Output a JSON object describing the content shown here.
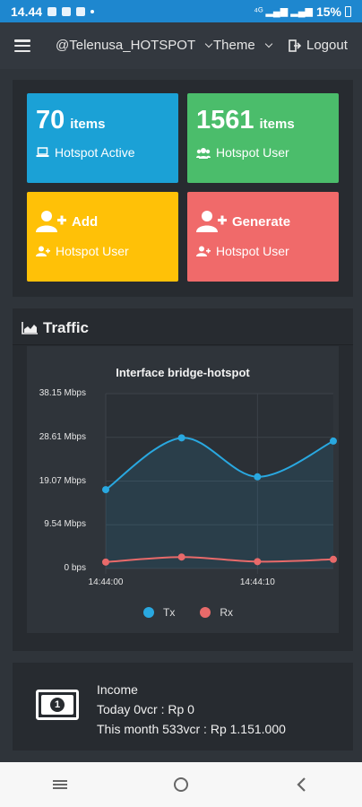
{
  "status": {
    "time": "14.44",
    "battery": "15%"
  },
  "nav": {
    "account": "@Telenusa_HOTSPOT",
    "theme": "Theme",
    "logout": "Logout"
  },
  "cards": [
    {
      "number": "70",
      "unit": "items",
      "label": "Hotspot Active",
      "color": "#1ba1d6"
    },
    {
      "number": "1561",
      "unit": "items",
      "label": "Hotspot User",
      "color": "#4bbd6b"
    },
    {
      "title": "Add",
      "label": "Hotspot User",
      "color": "#ffc107"
    },
    {
      "title": "Generate",
      "label": "Hotspot User",
      "color": "#f06a6a"
    }
  ],
  "traffic": {
    "title": "Traffic"
  },
  "chart_data": {
    "type": "line",
    "title": "Interface bridge-hotspot",
    "x": [
      "14:44:00",
      "14:44:05",
      "14:44:10",
      "14:44:15"
    ],
    "x_tick_labels": [
      "14:44:00",
      "14:44:10"
    ],
    "y_tick_labels": [
      "38.15 Mbps",
      "28.61 Mbps",
      "19.07 Mbps",
      "9.54 Mbps",
      "0 bps"
    ],
    "ylim": [
      0,
      38.15
    ],
    "y_unit": "Mbps",
    "series": [
      {
        "name": "Tx",
        "color": "#29a8e0",
        "values": [
          17.2,
          28.5,
          20.0,
          27.8
        ]
      },
      {
        "name": "Rx",
        "color": "#e86a6a",
        "values": [
          1.4,
          2.5,
          1.5,
          2.0
        ]
      }
    ],
    "grid": true,
    "legend": "bottom"
  },
  "income": {
    "title": "Income",
    "today": "Today 0vcr : Rp 0",
    "month": "This month 533vcr : Rp 1.151.000"
  }
}
